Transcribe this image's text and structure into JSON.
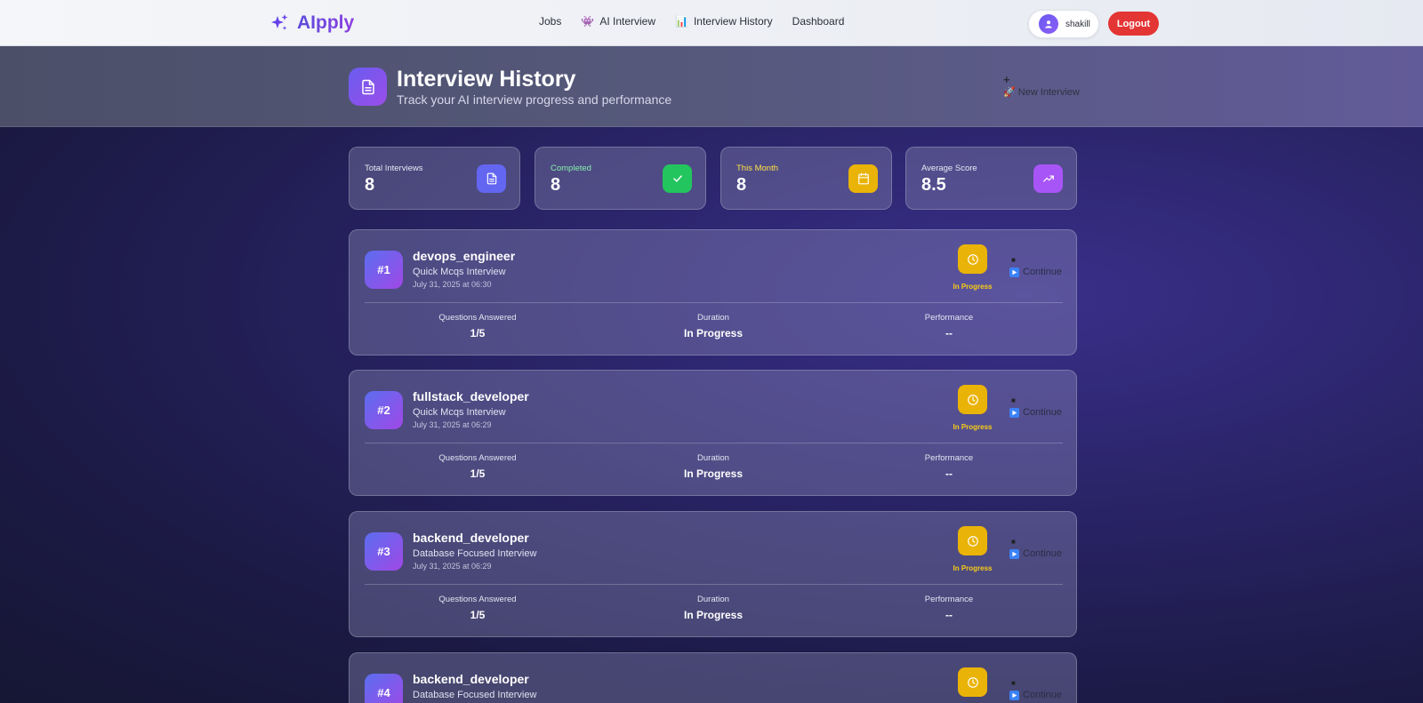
{
  "nav": {
    "brand": "AIpply",
    "links": [
      {
        "label": "Jobs",
        "emoji": ""
      },
      {
        "label": "AI Interview",
        "emoji": "👾"
      },
      {
        "label": "Interview History",
        "emoji": "📊"
      },
      {
        "label": "Dashboard",
        "emoji": ""
      }
    ],
    "user": "shakill",
    "logout": "Logout"
  },
  "header": {
    "title": "Interview History",
    "subtitle": "Track your AI interview progress and performance",
    "new_interview_plus": "+",
    "new_interview": "🚀 New Interview"
  },
  "stats": [
    {
      "label": "Total Interviews",
      "value": "8",
      "icon": "document-icon",
      "color": "#6366f1",
      "label_color": "#e8e9f3"
    },
    {
      "label": "Completed",
      "value": "8",
      "icon": "check-icon",
      "color": "#22c55e",
      "label_color": "#86efac"
    },
    {
      "label": "This Month",
      "value": "8",
      "icon": "calendar-icon",
      "color": "#eab308",
      "label_color": "#fde047"
    },
    {
      "label": "Average Score",
      "value": "8.5",
      "icon": "trending-up-icon",
      "color": "#a855f7",
      "label_color": "#e8e9f3"
    }
  ],
  "metric_labels": {
    "questions": "Questions Answered",
    "duration": "Duration",
    "performance": "Performance"
  },
  "interviews": [
    {
      "num": "#1",
      "role": "devops_engineer",
      "type": "Quick Mcqs Interview",
      "date": "July 31, 2025 at 06:30",
      "status": "In Progress",
      "continue_dot": "■",
      "continue": "Continue",
      "questions": "1/5",
      "duration": "In Progress",
      "performance": "--"
    },
    {
      "num": "#2",
      "role": "fullstack_developer",
      "type": "Quick Mcqs Interview",
      "date": "July 31, 2025 at 06:29",
      "status": "In Progress",
      "continue_dot": "■",
      "continue": "Continue",
      "questions": "1/5",
      "duration": "In Progress",
      "performance": "--"
    },
    {
      "num": "#3",
      "role": "backend_developer",
      "type": "Database Focused Interview",
      "date": "July 31, 2025 at 06:29",
      "status": "In Progress",
      "continue_dot": "■",
      "continue": "Continue",
      "questions": "1/5",
      "duration": "In Progress",
      "performance": "--"
    },
    {
      "num": "#4",
      "role": "backend_developer",
      "type": "Database Focused Interview",
      "date": "",
      "status": "",
      "continue_dot": "■",
      "continue": "Continue",
      "questions": "",
      "duration": "",
      "performance": ""
    }
  ]
}
